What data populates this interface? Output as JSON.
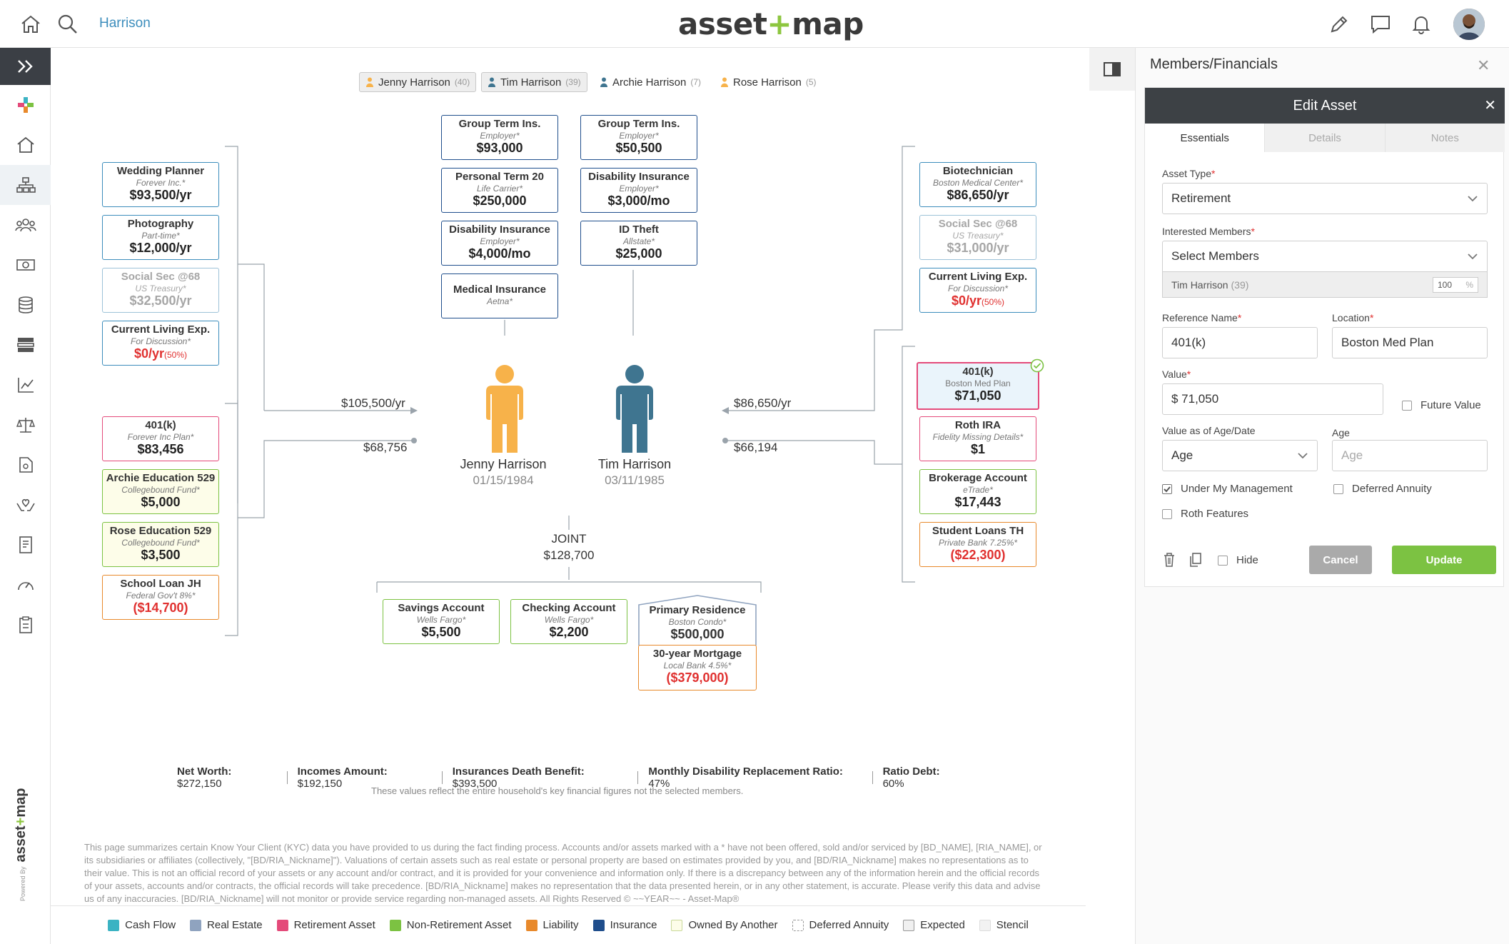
{
  "topbar": {
    "household": "Harrison",
    "logo_left": "asset",
    "logo_plus": "+",
    "logo_right": "map"
  },
  "members": [
    {
      "name": "Jenny Harrison",
      "age": "(40)"
    },
    {
      "name": "Tim Harrison",
      "age": "(39)"
    },
    {
      "name": "Archie Harrison",
      "age": "(7)"
    },
    {
      "name": "Rose Harrison",
      "age": "(5)"
    }
  ],
  "cards": {
    "wedding": {
      "title": "Wedding Planner",
      "sub": "Forever Inc.*",
      "value": "$93,500/yr"
    },
    "photo": {
      "title": "Photography",
      "sub": "Part-time*",
      "value": "$12,000/yr"
    },
    "ss_jenny": {
      "title": "Social Sec @68",
      "sub": "US Treasury*",
      "value": "$32,500/yr"
    },
    "cle_jenny": {
      "title": "Current Living Exp.",
      "sub": "For Discussion*",
      "value": "$0/yr",
      "pct": "(50%)"
    },
    "k401_jenny": {
      "title": "401(k)",
      "sub": "Forever Inc Plan*",
      "value": "$83,456"
    },
    "archie529": {
      "title": "Archie Education 529",
      "sub": "Collegebound Fund*",
      "value": "$5,000"
    },
    "rose529": {
      "title": "Rose Education 529",
      "sub": "Collegebound Fund*",
      "value": "$3,500"
    },
    "schoolloan": {
      "title": "School Loan JH",
      "sub": "Federal Gov't 8%*",
      "value": "($14,700)"
    },
    "gti_jenny": {
      "title": "Group Term Ins.",
      "sub": "Employer*",
      "value": "$93,000"
    },
    "pt20": {
      "title": "Personal Term 20",
      "sub": "Life Carrier*",
      "value": "$250,000"
    },
    "di_jenny": {
      "title": "Disability Insurance",
      "sub": "Employer*",
      "value": "$4,000/mo"
    },
    "medical": {
      "title": "Medical Insurance",
      "sub": "Aetna*"
    },
    "gti_tim": {
      "title": "Group Term Ins.",
      "sub": "Employer*",
      "value": "$50,500"
    },
    "di_tim": {
      "title": "Disability Insurance",
      "sub": "Employer*",
      "value": "$3,000/mo"
    },
    "idtheft": {
      "title": "ID Theft",
      "sub": "Allstate*",
      "value": "$25,000"
    },
    "biotech": {
      "title": "Biotechnician",
      "sub": "Boston Medical Center*",
      "value": "$86,650/yr"
    },
    "ss_tim": {
      "title": "Social Sec @68",
      "sub": "US Treasury*",
      "value": "$31,000/yr"
    },
    "cle_tim": {
      "title": "Current Living Exp.",
      "sub": "For Discussion*",
      "value": "$0/yr",
      "pct": "(50%)"
    },
    "k401_tim": {
      "title": "401(k)",
      "sub": "Boston Med Plan",
      "value": "$71,050"
    },
    "rothira": {
      "title": "Roth IRA",
      "sub": "Fidelity Missing Details*",
      "value": "$1"
    },
    "brokerage": {
      "title": "Brokerage Account",
      "sub": "eTrade*",
      "value": "$17,443"
    },
    "studentloans": {
      "title": "Student Loans TH",
      "sub": "Private Bank 7.25%*",
      "value": "($22,300)"
    },
    "savings": {
      "title": "Savings Account",
      "sub": "Wells Fargo*",
      "value": "$5,500"
    },
    "checking": {
      "title": "Checking Account",
      "sub": "Wells Fargo*",
      "value": "$2,200"
    },
    "residence": {
      "title": "Primary Residence",
      "sub": "Boston Condo*",
      "value": "$500,000"
    },
    "mortgage": {
      "title": "30-year Mortgage",
      "sub": "Local Bank 4.5%*",
      "value": "($379,000)"
    }
  },
  "flows": {
    "jenny_income": "$105,500/yr",
    "jenny_assets": "$68,756",
    "tim_income": "$86,650/yr",
    "tim_assets": "$66,194"
  },
  "people": {
    "jenny": {
      "name": "Jenny Harrison",
      "dob": "01/15/1984"
    },
    "tim": {
      "name": "Tim Harrison",
      "dob": "03/11/1985"
    }
  },
  "joint": {
    "label": "JOINT",
    "value": "$128,700"
  },
  "summary": {
    "net_worth_label": "Net Worth:",
    "net_worth": "$272,150",
    "incomes_label": "Incomes Amount:",
    "incomes": "$192,150",
    "death_label": "Insurances Death Benefit:",
    "death": "$393,500",
    "disability_label": "Monthly Disability Replacement Ratio:",
    "disability": "47%",
    "debt_label": "Ratio Debt:",
    "debt": "60%",
    "note": "These values reflect the entire household's key financial figures not the selected members."
  },
  "disclaimer": "This page summarizes certain Know Your Client (KYC) data you have provided to us during the fact finding process. Accounts and/or assets marked with a * have not been offered, sold and/or serviced by [BD_NAME], [RIA_NAME], or its subsidiaries or affiliates (collectively, \"[BD/RIA_Nickname]\"). Valuations of certain assets such as real estate or personal property are based on estimates provided by you, and [BD/RIA_Nickname] makes no representations as to their value. This is not an official record of your assets or any account and/or contract, and it is provided for your convenience and information only. If there is a discrepancy between any of the information herein and the official records of your assets, accounts and/or contracts, the official records will take precedence. [BD/RIA_Nickname] makes no representation that the data presented herein, or in any other statement, is accurate. Please verify this data and advise us of any inaccuracies. [BD/RIA_Nickname] will not monitor or provide service regarding non-managed assets. All Rights Reserved © ~~YEAR~~ - Asset-Map®",
  "legend": [
    {
      "label": "Cash Flow",
      "color": "#3bb3c3"
    },
    {
      "label": "Real Estate",
      "color": "#8fa3bf"
    },
    {
      "label": "Retirement Asset",
      "color": "#e44a7a"
    },
    {
      "label": "Non-Retirement Asset",
      "color": "#7cc242"
    },
    {
      "label": "Liability",
      "color": "#e8892b"
    },
    {
      "label": "Insurance",
      "color": "#1f4e8c"
    },
    {
      "label": "Owned By Another",
      "color": "#fdfde9"
    },
    {
      "label": "Deferred Annuity",
      "color": "#ffffff"
    },
    {
      "label": "Expected",
      "color": "#f0f0f0"
    },
    {
      "label": "Stencil",
      "color": "#f2f2f2"
    }
  ],
  "panel": {
    "title": "Members/Financials",
    "edit_title": "Edit Asset",
    "tabs": [
      "Essentials",
      "Details",
      "Notes"
    ],
    "asset_type_label": "Asset Type",
    "asset_type": "Retirement",
    "members_label": "Interested Members",
    "members_placeholder": "Select Members",
    "member_row_name": "Tim Harrison",
    "member_row_age": "(39)",
    "member_row_pct": "100",
    "pct_sign": "%",
    "ref_label": "Reference Name",
    "ref_value": "401(k)",
    "location_label": "Location",
    "location_value": "Boston Med Plan",
    "value_label": "Value",
    "value_value": "$ 71,050",
    "future_value": "Future Value",
    "age_date_label": "Value as of Age/Date",
    "age_date_value": "Age",
    "age_label": "Age",
    "age_placeholder": "Age",
    "under_mgmt": "Under My Management",
    "deferred_annuity": "Deferred Annuity",
    "roth": "Roth Features",
    "hide": "Hide",
    "cancel": "Cancel",
    "update": "Update"
  },
  "powered_by": "Powered By",
  "colors": {
    "accent": "#8dc63f",
    "link": "#3c8dbc",
    "negative": "#e0302f"
  }
}
